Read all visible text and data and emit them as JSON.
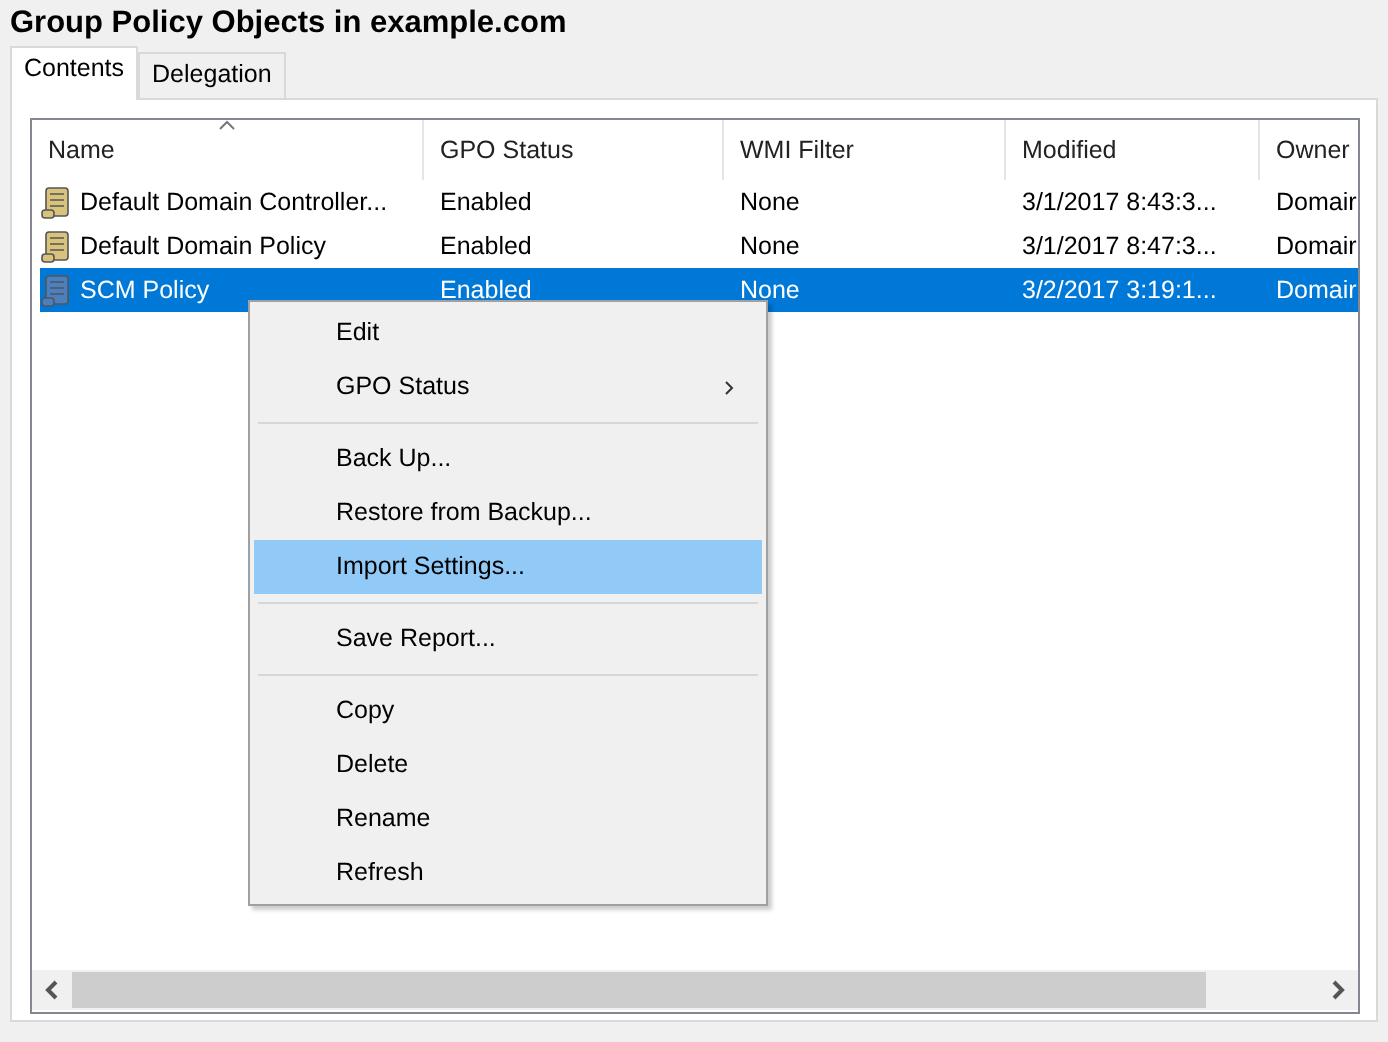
{
  "title": "Group Policy Objects in example.com",
  "tabs": [
    {
      "label": "Contents",
      "selected": true
    },
    {
      "label": "Delegation",
      "selected": false
    }
  ],
  "table": {
    "columns": [
      {
        "label": "Name",
        "sorted": true
      },
      {
        "label": "GPO Status",
        "sorted": false
      },
      {
        "label": "WMI Filter",
        "sorted": false
      },
      {
        "label": "Modified",
        "sorted": false
      },
      {
        "label": "Owner",
        "sorted": false
      }
    ],
    "rows": [
      {
        "selected": false,
        "cells": [
          "Default Domain Controller...",
          "Enabled",
          "None",
          "3/1/2017 8:43:3...",
          "Domair"
        ]
      },
      {
        "selected": false,
        "cells": [
          "Default Domain Policy",
          "Enabled",
          "None",
          "3/1/2017 8:47:3...",
          "Domair"
        ]
      },
      {
        "selected": true,
        "cells": [
          "SCM Policy",
          "Enabled",
          "None",
          "3/2/2017 3:19:1...",
          "Domair"
        ]
      }
    ]
  },
  "context_menu": [
    {
      "kind": "item",
      "label": "Edit",
      "submenu": false,
      "selected": false
    },
    {
      "kind": "item",
      "label": "GPO Status",
      "submenu": true,
      "selected": false
    },
    {
      "kind": "separator"
    },
    {
      "kind": "item",
      "label": "Back Up...",
      "submenu": false,
      "selected": false
    },
    {
      "kind": "item",
      "label": "Restore from Backup...",
      "submenu": false,
      "selected": false
    },
    {
      "kind": "item",
      "label": "Import Settings...",
      "submenu": false,
      "selected": true
    },
    {
      "kind": "separator"
    },
    {
      "kind": "item",
      "label": "Save Report...",
      "submenu": false,
      "selected": false
    },
    {
      "kind": "separator"
    },
    {
      "kind": "item",
      "label": "Copy",
      "submenu": false,
      "selected": false
    },
    {
      "kind": "item",
      "label": "Delete",
      "submenu": false,
      "selected": false
    },
    {
      "kind": "item",
      "label": "Rename",
      "submenu": false,
      "selected": false
    },
    {
      "kind": "item",
      "label": "Refresh",
      "submenu": false,
      "selected": false
    }
  ]
}
